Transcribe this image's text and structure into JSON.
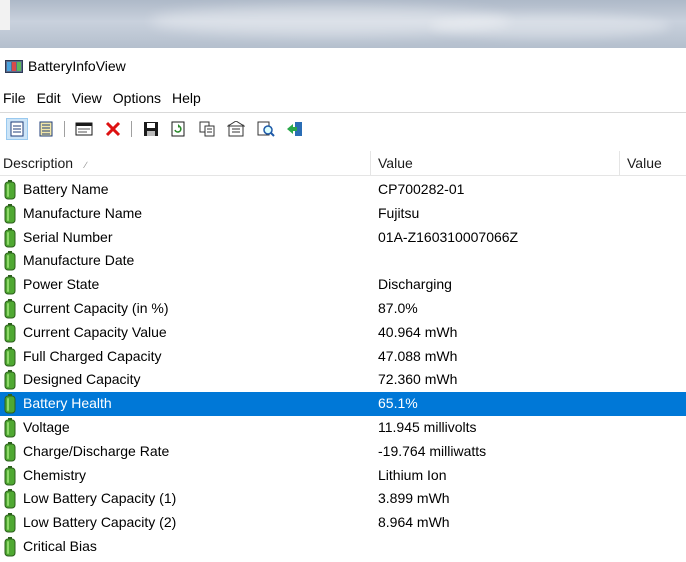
{
  "window": {
    "title": "BatteryInfoView"
  },
  "menu": [
    "File",
    "Edit",
    "View",
    "Options",
    "Help"
  ],
  "toolbar": {
    "buttons": [
      "properties-view-icon",
      "list-view-icon",
      "html-report-icon",
      "close-red-x-icon",
      "save-icon",
      "refresh-icon",
      "copy-icon",
      "properties-icon",
      "find-icon",
      "exit-icon"
    ]
  },
  "table": {
    "columns": [
      "Description",
      "Value",
      "Value"
    ],
    "rows": [
      {
        "desc": "Battery Name",
        "value": "CP700282-01"
      },
      {
        "desc": "Manufacture Name",
        "value": "Fujitsu"
      },
      {
        "desc": "Serial Number",
        "value": "01A-Z160310007066Z"
      },
      {
        "desc": "Manufacture Date",
        "value": ""
      },
      {
        "desc": "Power State",
        "value": "Discharging"
      },
      {
        "desc": "Current Capacity (in %)",
        "value": "87.0%"
      },
      {
        "desc": "Current Capacity Value",
        "value": "40.964 mWh"
      },
      {
        "desc": "Full Charged Capacity",
        "value": "47.088 mWh"
      },
      {
        "desc": "Designed Capacity",
        "value": "72.360 mWh"
      },
      {
        "desc": "Battery Health",
        "value": "65.1%"
      },
      {
        "desc": "Voltage",
        "value": "11.945 millivolts"
      },
      {
        "desc": "Charge/Discharge Rate",
        "value": "-19.764 milliwatts"
      },
      {
        "desc": "Chemistry",
        "value": "Lithium Ion"
      },
      {
        "desc": "Low Battery Capacity (1)",
        "value": "3.899 mWh"
      },
      {
        "desc": "Low Battery Capacity (2)",
        "value": "8.964 mWh"
      },
      {
        "desc": "Critical Bias",
        "value": ""
      }
    ],
    "selected_row": "Battery Health"
  },
  "colors": {
    "selection": "#0078d7",
    "battery_green": "#3d8a26"
  }
}
